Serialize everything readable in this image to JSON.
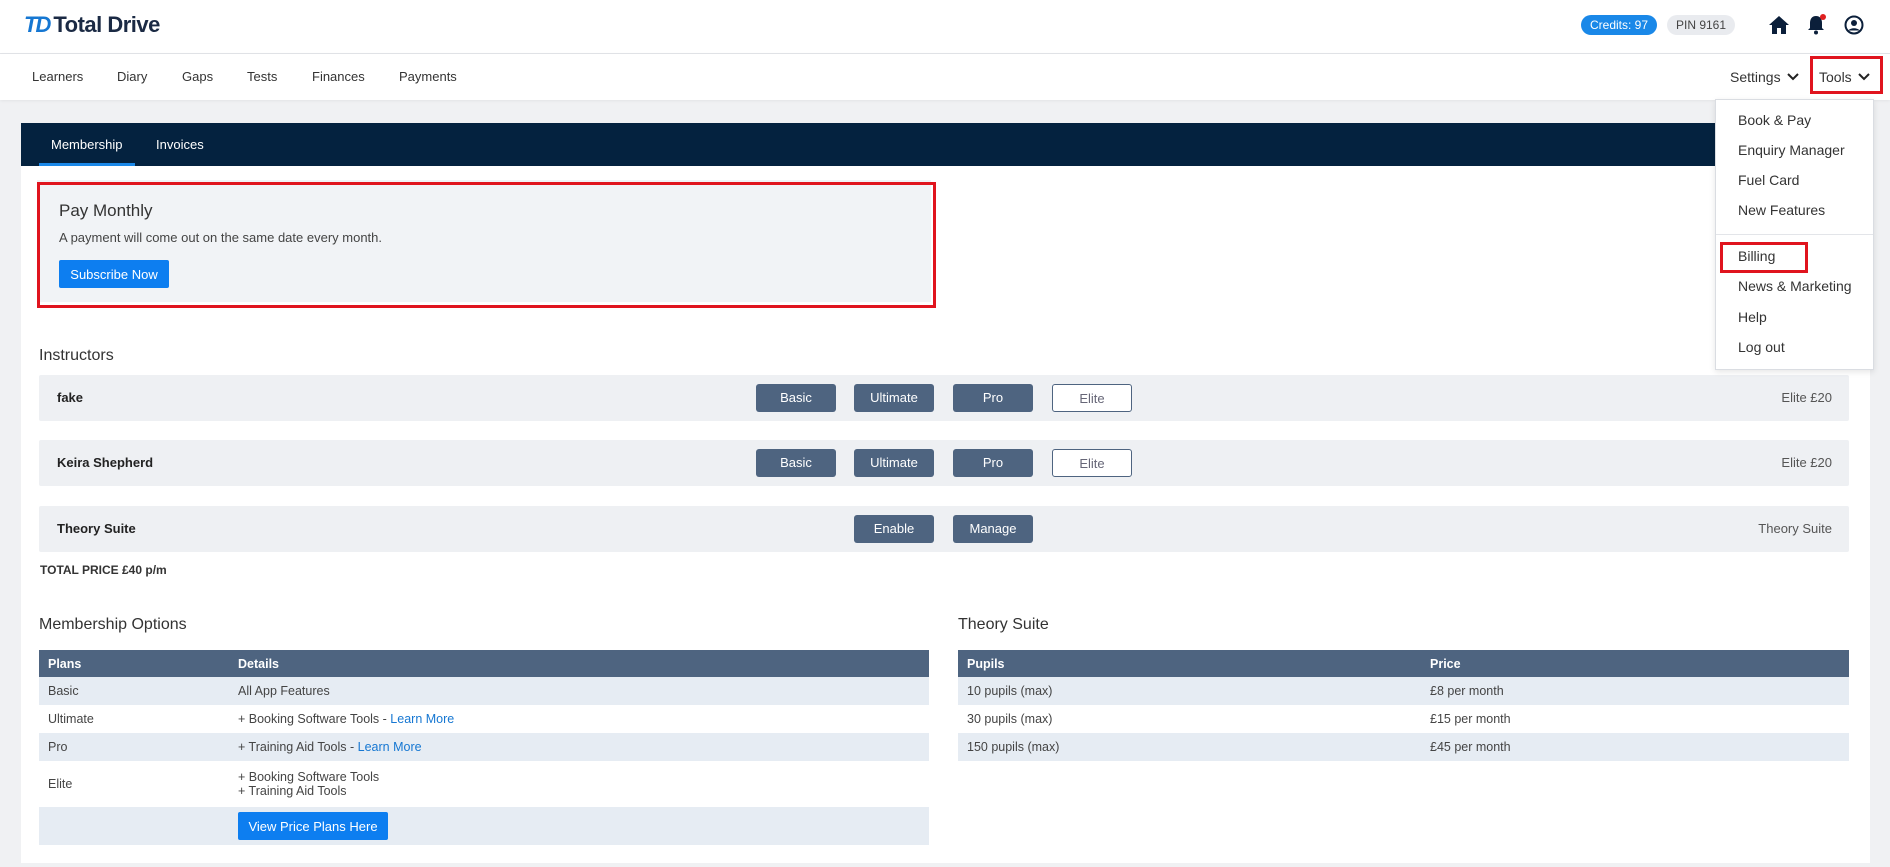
{
  "brand": {
    "mark": "TD",
    "name": "Total Drive"
  },
  "header": {
    "credits": "Credits: 97",
    "pin": "PIN 9161"
  },
  "nav": {
    "items": [
      "Learners",
      "Diary",
      "Gaps",
      "Tests",
      "Finances",
      "Payments"
    ],
    "settings": "Settings",
    "tools": "Tools"
  },
  "tools_menu": {
    "group1": [
      "Book & Pay",
      "Enquiry Manager",
      "Fuel Card",
      "New Features"
    ],
    "group2": [
      "Billing",
      "News & Marketing",
      "Help",
      "Log out"
    ]
  },
  "tabs": [
    "Membership",
    "Invoices"
  ],
  "pay_monthly": {
    "title": "Pay Monthly",
    "description": "A payment will come out on the same date every month.",
    "button": "Subscribe Now"
  },
  "instructors": {
    "title": "Instructors",
    "plan_labels": [
      "Basic",
      "Ultimate",
      "Pro",
      "Elite"
    ],
    "rows": [
      {
        "name": "fake",
        "current": "Elite £20"
      },
      {
        "name": "Keira Shepherd",
        "current": "Elite £20"
      }
    ],
    "theory": {
      "name": "Theory Suite",
      "enable": "Enable",
      "manage": "Manage",
      "status": "Theory Suite"
    },
    "total": "TOTAL PRICE £40  p/m"
  },
  "membership_options": {
    "title": "Membership Options",
    "headers": [
      "Plans",
      "Details"
    ],
    "rows": [
      {
        "plan": "Basic",
        "detail": "All App Features",
        "link": ""
      },
      {
        "plan": "Ultimate",
        "detail": "+ Booking Software Tools - ",
        "link": "Learn More"
      },
      {
        "plan": "Pro",
        "detail": "+ Training Aid Tools - ",
        "link": "Learn More"
      },
      {
        "plan": "Elite",
        "detail": "+ Booking Software Tools",
        "detail2": "+ Training Aid Tools"
      }
    ],
    "button": "View Price Plans Here"
  },
  "theory_suite": {
    "title": "Theory Suite",
    "headers": [
      "Pupils",
      "Price"
    ],
    "rows": [
      {
        "pupils": "10 pupils (max)",
        "price": "£8 per month"
      },
      {
        "pupils": "30 pupils (max)",
        "price": "£15 per month"
      },
      {
        "pupils": "150 pupils (max)",
        "price": "£45 per month"
      }
    ]
  }
}
